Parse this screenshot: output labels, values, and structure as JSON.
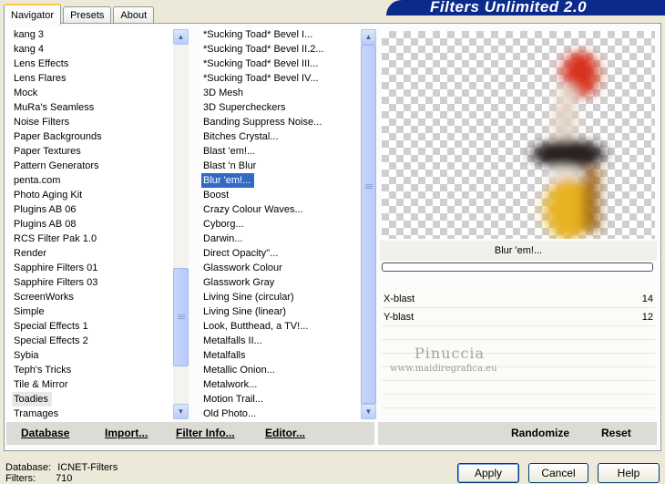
{
  "tabs": [
    "Navigator",
    "Presets",
    "About"
  ],
  "banner_title": "Filters Unlimited 2.0",
  "categories": [
    "kang 3",
    "kang 4",
    "Lens Effects",
    "Lens Flares",
    "Mock",
    "MuRa's Seamless",
    "Noise Filters",
    "Paper Backgrounds",
    "Paper Textures",
    "Pattern Generators",
    "penta.com",
    "Photo Aging Kit",
    "Plugins AB 06",
    "Plugins AB 08",
    "RCS Filter Pak 1.0",
    "Render",
    "Sapphire Filters 01",
    "Sapphire Filters 03",
    "ScreenWorks",
    "Simple",
    "Special Effects 1",
    "Special Effects 2",
    "Sybia",
    "Teph's Tricks",
    "Tile & Mirror",
    "Toadies",
    "Tramages"
  ],
  "selected_category": "Toadies",
  "filters": [
    "*Sucking Toad*  Bevel I...",
    "*Sucking Toad*  Bevel II.2...",
    "*Sucking Toad*  Bevel III...",
    "*Sucking Toad*  Bevel IV...",
    "3D Mesh",
    "3D Supercheckers",
    "Banding Suppress Noise...",
    "Bitches Crystal...",
    "Blast 'em!...",
    "Blast 'n Blur",
    "Blur 'em!...",
    "Boost",
    "Crazy Colour Waves...",
    "Cyborg...",
    "Darwin...",
    "Direct Opacity''...",
    "Glasswork Colour",
    "Glasswork Gray",
    "Living Sine (circular)",
    "Living Sine (linear)",
    "Look, Butthead, a TV!...",
    "Metalfalls II...",
    "Metalfalls",
    "Metallic Onion...",
    "Metalwork...",
    "Motion Trail...",
    "Old Photo..."
  ],
  "selected_filter": "Blur 'em!...",
  "left_bar": {
    "database": "Database",
    "import": "Import...",
    "filter_info": "Filter Info...",
    "editor": "Editor..."
  },
  "right_bar": {
    "randomize": "Randomize",
    "reset": "Reset"
  },
  "params": [
    {
      "label": "X-blast",
      "value": "14"
    },
    {
      "label": "Y-blast",
      "value": "12"
    }
  ],
  "watermark": {
    "name": "Pinuccia",
    "url": "www.maidiregrafica.eu"
  },
  "status": {
    "database_label": "Database:",
    "database_value": "ICNET-Filters",
    "filters_label": "Filters:",
    "filters_value": "710"
  },
  "buttons": {
    "apply": "Apply",
    "cancel": "Cancel",
    "help": "Help"
  },
  "colors": {
    "banner": "#0a2a8c",
    "selection": "#316ac5",
    "background": "#ece9d8"
  }
}
